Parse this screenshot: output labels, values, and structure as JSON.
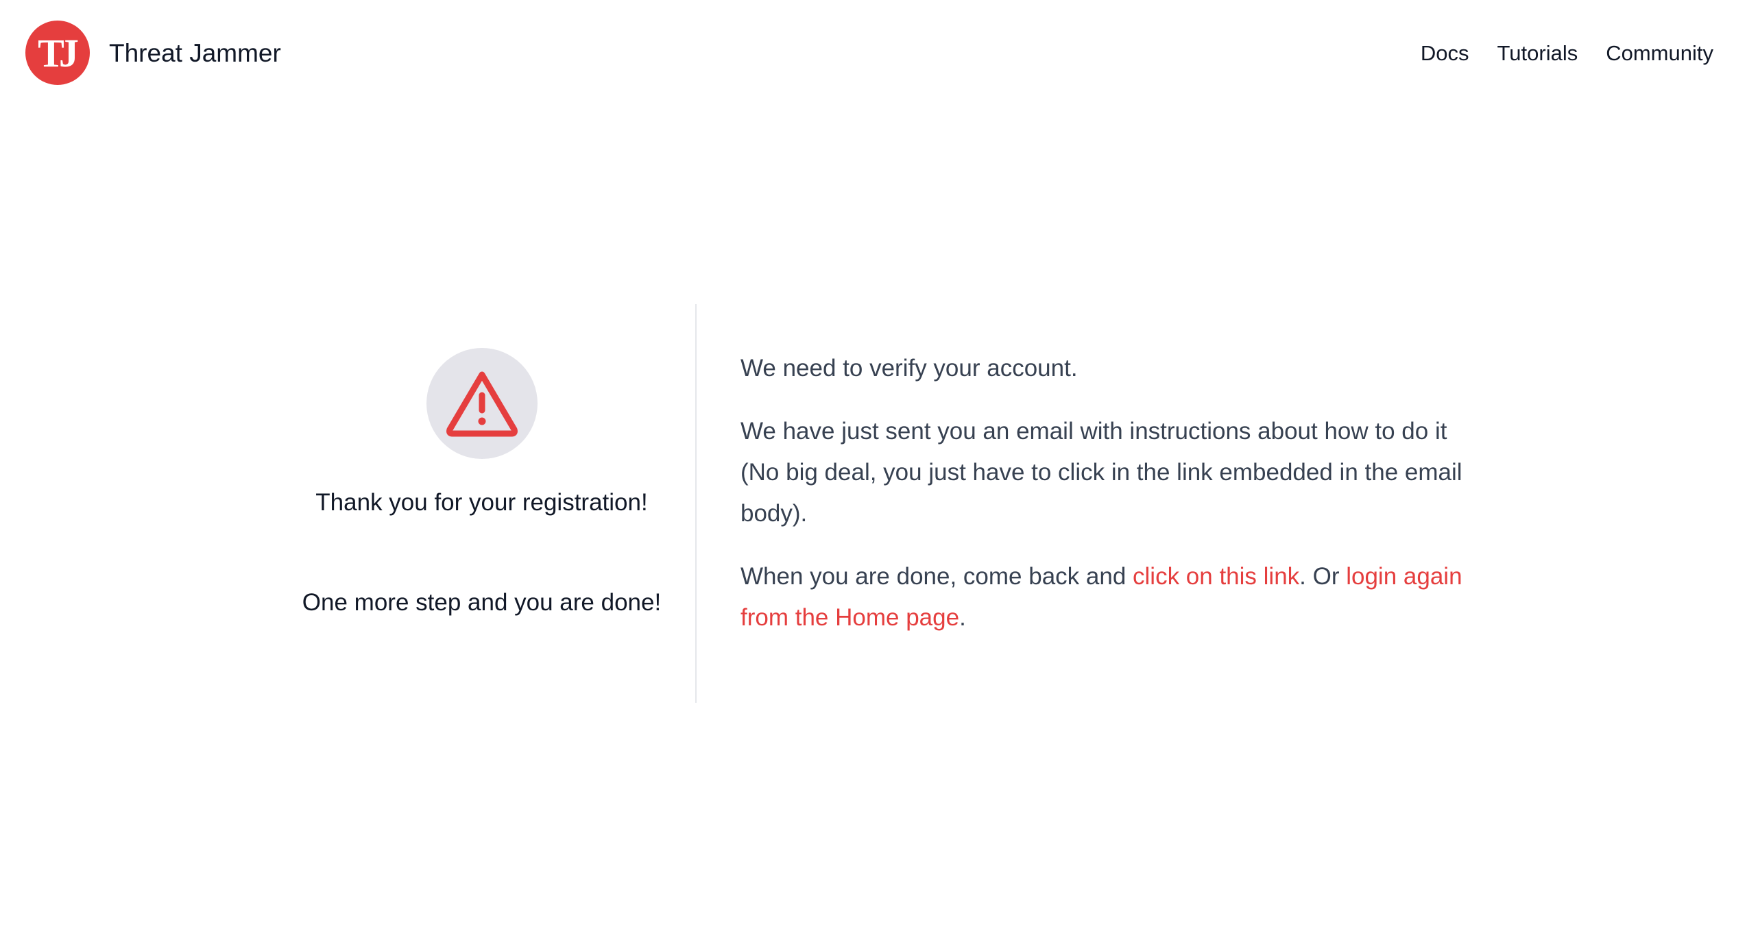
{
  "header": {
    "logo_text": "TJ",
    "brand_name": "Threat Jammer",
    "nav": [
      {
        "label": "Docs"
      },
      {
        "label": "Tutorials"
      },
      {
        "label": "Community"
      }
    ]
  },
  "left": {
    "icon": "warning-triangle-icon",
    "thanks": "Thank you for your registration!",
    "one_more": "One more step and you are done!"
  },
  "right": {
    "verify": "We need to verify your account.",
    "email_sent": "We have just sent you an email with instructions about how to do it (No big deal, you just have to click in the link embedded in the email body).",
    "done_prefix": "When you are done, come back and ",
    "link_click": "click on this link",
    "or_text": ". Or ",
    "link_login": "login again from the Home page",
    "suffix": "."
  },
  "colors": {
    "accent": "#e53e3e",
    "icon_bg": "#e4e4ea",
    "body_text": "#374151",
    "heading_text": "#111827",
    "divider": "#e5e7eb"
  }
}
